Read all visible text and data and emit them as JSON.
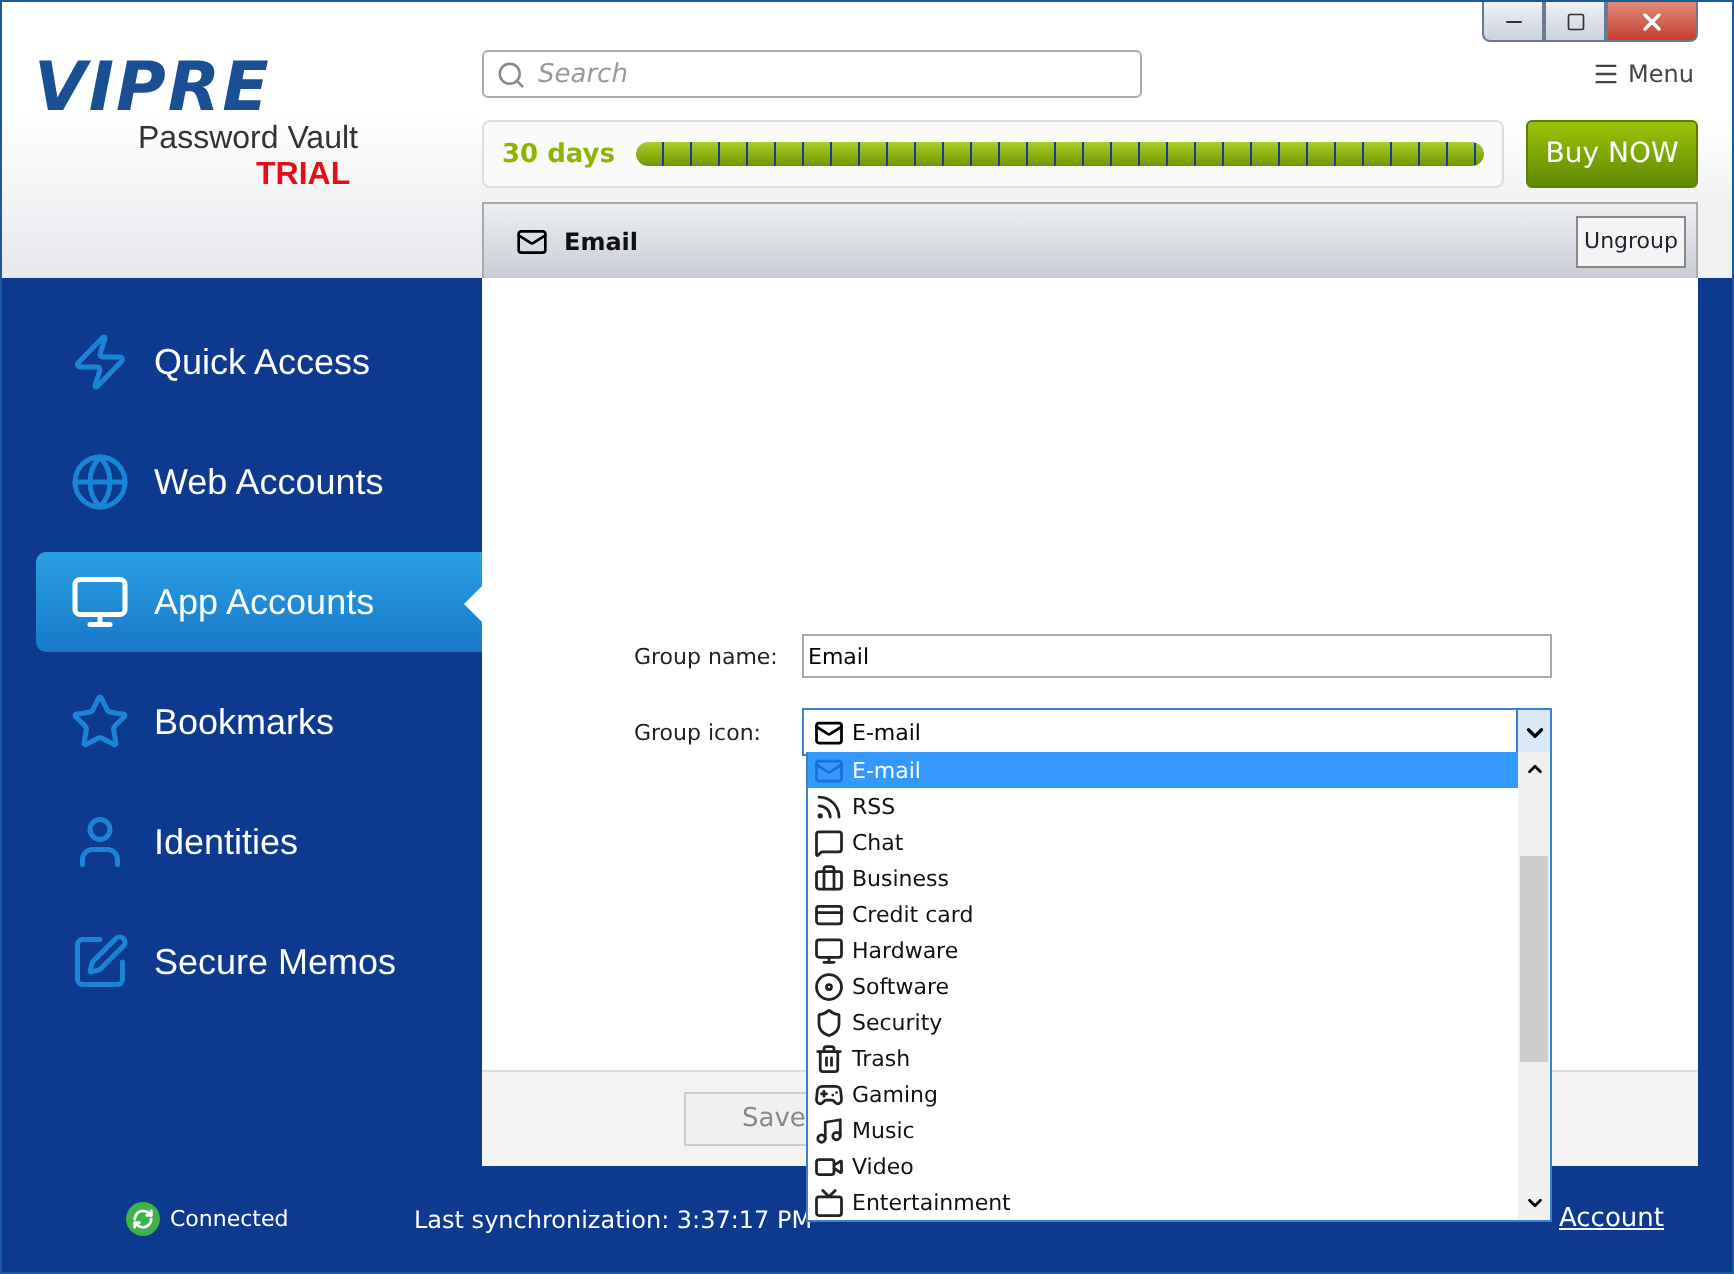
{
  "logo": {
    "brand": "VIPRE",
    "product": "Password Vault",
    "edition": "TRIAL"
  },
  "search": {
    "placeholder": "Search"
  },
  "menu": {
    "label": "Menu"
  },
  "trial": {
    "label": "30 days",
    "level": 1
  },
  "buy_button": {
    "label": "Buy NOW"
  },
  "sidebar": {
    "items": [
      {
        "label": "Quick Access",
        "kind": "bolt",
        "selected": false
      },
      {
        "label": "Web Accounts",
        "kind": "globe",
        "selected": false
      },
      {
        "label": "App Accounts",
        "kind": "monitor",
        "selected": true
      },
      {
        "label": "Bookmarks",
        "kind": "star",
        "selected": false
      },
      {
        "label": "Identities",
        "kind": "person",
        "selected": false
      },
      {
        "label": "Secure Memos",
        "kind": "memo",
        "selected": false
      }
    ]
  },
  "group_header": {
    "title": "Email",
    "ungroup_button": "Ungroup"
  },
  "form": {
    "name_label": "Group name:",
    "name_value": "Email",
    "icon_label": "Group icon:",
    "icon_value": "E-mail",
    "save_button": "Save"
  },
  "icon_dropdown": {
    "items": [
      {
        "label": "E-mail",
        "kind": "mail",
        "selected": true
      },
      {
        "label": "RSS",
        "kind": "rss",
        "selected": false
      },
      {
        "label": "Chat",
        "kind": "chat",
        "selected": false
      },
      {
        "label": "Business",
        "kind": "briefcase",
        "selected": false
      },
      {
        "label": "Credit card",
        "kind": "card",
        "selected": false
      },
      {
        "label": "Hardware",
        "kind": "monitor",
        "selected": false
      },
      {
        "label": "Software",
        "kind": "disc",
        "selected": false
      },
      {
        "label": "Security",
        "kind": "shield",
        "selected": false
      },
      {
        "label": "Trash",
        "kind": "trash",
        "selected": false
      },
      {
        "label": "Gaming",
        "kind": "gamepad",
        "selected": false
      },
      {
        "label": "Music",
        "kind": "music",
        "selected": false
      },
      {
        "label": "Video",
        "kind": "video",
        "selected": false
      },
      {
        "label": "Entertainment",
        "kind": "tv",
        "selected": false
      }
    ]
  },
  "status_bar": {
    "connection": "Connected",
    "sync": "Last synchronization: 3:37:17 PM",
    "account_link": "Account"
  }
}
